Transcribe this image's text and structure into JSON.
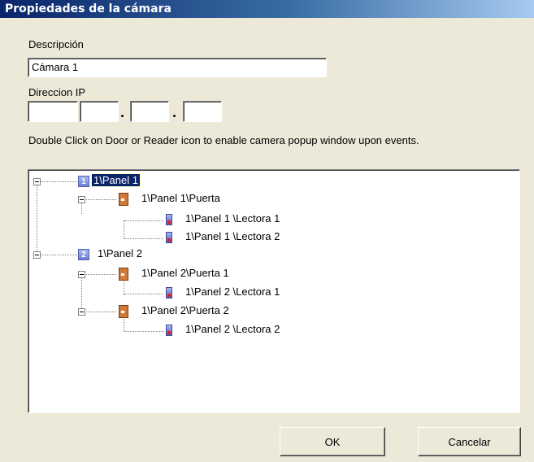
{
  "window": {
    "title": "Propiedades de la cámara"
  },
  "form": {
    "description_label": "Descripción",
    "description_value": "Cámara  1",
    "ip_label": "Direccion IP",
    "ip_octets": [
      "",
      "",
      "",
      ""
    ],
    "ip_separator": ".",
    "hint": "Double Click on Door or Reader icon to enable camera popup window upon events."
  },
  "tree": {
    "nodes": [
      {
        "type": "panel",
        "icon_glyph": "1",
        "label": "1\\Panel  1",
        "selected": true
      },
      {
        "type": "door",
        "label": "1\\Panel  1\\Puerta"
      },
      {
        "type": "reader",
        "label": "1\\Panel 1 \\Lectora 1"
      },
      {
        "type": "reader",
        "label": "1\\Panel 1 \\Lectora 2"
      },
      {
        "type": "panel",
        "icon_glyph": "2",
        "label": "1\\Panel  2"
      },
      {
        "type": "door",
        "label": "1\\Panel  2\\Puerta  1"
      },
      {
        "type": "reader",
        "label": "1\\Panel 2 \\Lectora 1"
      },
      {
        "type": "door",
        "label": "1\\Panel  2\\Puerta  2"
      },
      {
        "type": "reader",
        "label": "1\\Panel 2 \\Lectora 2"
      }
    ]
  },
  "buttons": {
    "ok_label": "OK",
    "cancel_label": "Cancelar"
  }
}
